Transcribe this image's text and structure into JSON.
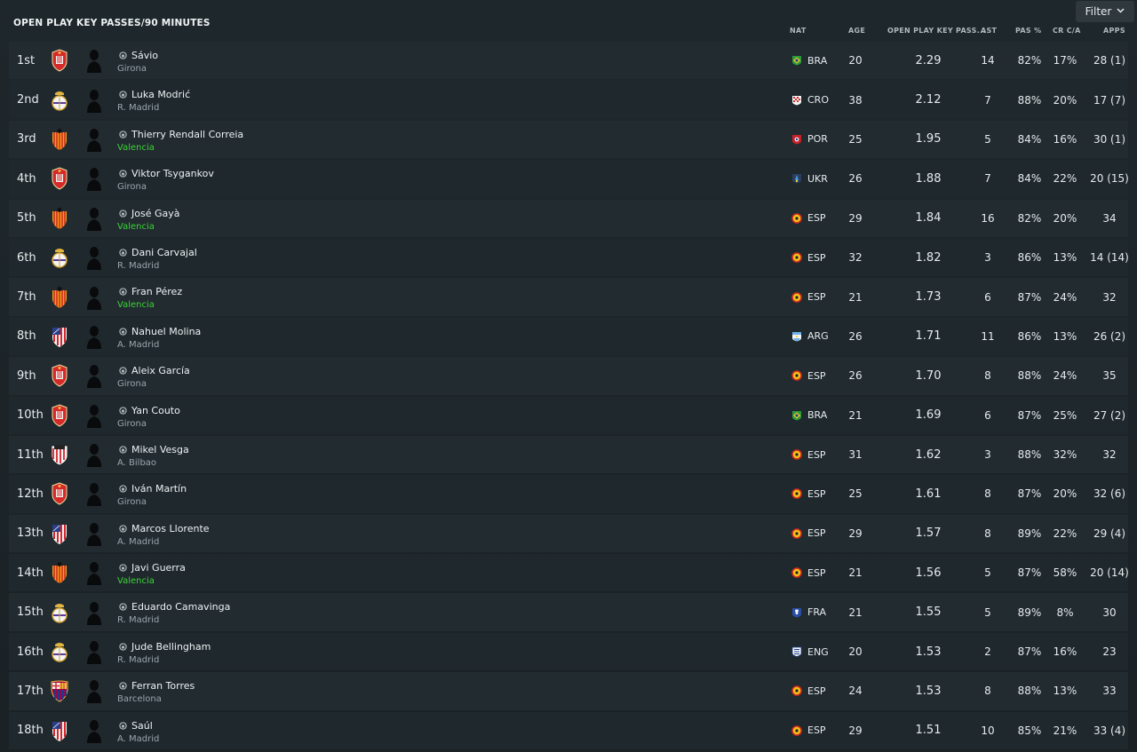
{
  "title": "OPEN PLAY KEY PASSES/90 MINUTES",
  "filter_label": "Filter",
  "columns": {
    "nat": "NAT",
    "age": "AGE",
    "kp": "OPEN PLAY KEY PASS...",
    "ast": "AST",
    "pas": "PAS %",
    "crc": "CR C/A",
    "apps": "APPS"
  },
  "colors": {
    "background": "#1b2428",
    "row": "#212b30",
    "valencia_text": "#3cd435",
    "club_text": "#9aa6ac"
  },
  "rows": [
    {
      "rank": "1st",
      "club_icon": "girona",
      "name": "Sávio",
      "club": "Girona",
      "nat_icon": "bra-flag",
      "nat": "BRA",
      "age": "20",
      "kp": "2.29",
      "ast": "14",
      "pas": "82%",
      "crc": "17%",
      "apps": "28 (1)"
    },
    {
      "rank": "2nd",
      "club_icon": "real-madrid",
      "name": "Luka Modrić",
      "club": "R. Madrid",
      "nat_icon": "cro-flag",
      "nat": "CRO",
      "age": "38",
      "kp": "2.12",
      "ast": "7",
      "pas": "88%",
      "crc": "20%",
      "apps": "17 (7)"
    },
    {
      "rank": "3rd",
      "club_icon": "valencia",
      "name": "Thierry Rendall Correia",
      "club": "Valencia",
      "nat_icon": "por-flag",
      "nat": "POR",
      "age": "25",
      "kp": "1.95",
      "ast": "5",
      "pas": "84%",
      "crc": "16%",
      "apps": "30 (1)"
    },
    {
      "rank": "4th",
      "club_icon": "girona",
      "name": "Viktor Tsygankov",
      "club": "Girona",
      "nat_icon": "ukr-flag",
      "nat": "UKR",
      "age": "26",
      "kp": "1.88",
      "ast": "7",
      "pas": "84%",
      "crc": "22%",
      "apps": "20 (15)"
    },
    {
      "rank": "5th",
      "club_icon": "valencia",
      "name": "José Gayà",
      "club": "Valencia",
      "nat_icon": "esp-flag",
      "nat": "ESP",
      "age": "29",
      "kp": "1.84",
      "ast": "16",
      "pas": "82%",
      "crc": "20%",
      "apps": "34"
    },
    {
      "rank": "6th",
      "club_icon": "real-madrid",
      "name": "Dani Carvajal",
      "club": "R. Madrid",
      "nat_icon": "esp-flag",
      "nat": "ESP",
      "age": "32",
      "kp": "1.82",
      "ast": "3",
      "pas": "86%",
      "crc": "13%",
      "apps": "14 (14)"
    },
    {
      "rank": "7th",
      "club_icon": "valencia",
      "name": "Fran Pérez",
      "club": "Valencia",
      "nat_icon": "esp-flag",
      "nat": "ESP",
      "age": "21",
      "kp": "1.73",
      "ast": "6",
      "pas": "87%",
      "crc": "24%",
      "apps": "32"
    },
    {
      "rank": "8th",
      "club_icon": "atletico",
      "name": "Nahuel Molina",
      "club": "A. Madrid",
      "nat_icon": "arg-flag",
      "nat": "ARG",
      "age": "26",
      "kp": "1.71",
      "ast": "11",
      "pas": "86%",
      "crc": "13%",
      "apps": "26 (2)"
    },
    {
      "rank": "9th",
      "club_icon": "girona",
      "name": "Aleix García",
      "club": "Girona",
      "nat_icon": "esp-flag",
      "nat": "ESP",
      "age": "26",
      "kp": "1.70",
      "ast": "8",
      "pas": "88%",
      "crc": "24%",
      "apps": "35"
    },
    {
      "rank": "10th",
      "club_icon": "girona",
      "name": "Yan Couto",
      "club": "Girona",
      "nat_icon": "bra-flag",
      "nat": "BRA",
      "age": "21",
      "kp": "1.69",
      "ast": "6",
      "pas": "87%",
      "crc": "25%",
      "apps": "27 (2)"
    },
    {
      "rank": "11th",
      "club_icon": "athletic",
      "name": "Mikel Vesga",
      "club": "A. Bilbao",
      "nat_icon": "esp-flag",
      "nat": "ESP",
      "age": "31",
      "kp": "1.62",
      "ast": "3",
      "pas": "88%",
      "crc": "32%",
      "apps": "32"
    },
    {
      "rank": "12th",
      "club_icon": "girona",
      "name": "Iván Martín",
      "club": "Girona",
      "nat_icon": "esp-flag",
      "nat": "ESP",
      "age": "25",
      "kp": "1.61",
      "ast": "8",
      "pas": "87%",
      "crc": "20%",
      "apps": "32 (6)"
    },
    {
      "rank": "13th",
      "club_icon": "atletico",
      "name": "Marcos Llorente",
      "club": "A. Madrid",
      "nat_icon": "esp-flag",
      "nat": "ESP",
      "age": "29",
      "kp": "1.57",
      "ast": "8",
      "pas": "89%",
      "crc": "22%",
      "apps": "29 (4)"
    },
    {
      "rank": "14th",
      "club_icon": "valencia",
      "name": "Javi Guerra",
      "club": "Valencia",
      "nat_icon": "esp-flag",
      "nat": "ESP",
      "age": "21",
      "kp": "1.56",
      "ast": "5",
      "pas": "87%",
      "crc": "58%",
      "apps": "20 (14)"
    },
    {
      "rank": "15th",
      "club_icon": "real-madrid",
      "name": "Eduardo Camavinga",
      "club": "R. Madrid",
      "nat_icon": "fra-flag",
      "nat": "FRA",
      "age": "21",
      "kp": "1.55",
      "ast": "5",
      "pas": "89%",
      "crc": "8%",
      "apps": "30"
    },
    {
      "rank": "16th",
      "club_icon": "real-madrid",
      "name": "Jude Bellingham",
      "club": "R. Madrid",
      "nat_icon": "eng-flag",
      "nat": "ENG",
      "age": "20",
      "kp": "1.53",
      "ast": "2",
      "pas": "87%",
      "crc": "16%",
      "apps": "23"
    },
    {
      "rank": "17th",
      "club_icon": "barcelona",
      "name": "Ferran Torres",
      "club": "Barcelona",
      "nat_icon": "esp-flag",
      "nat": "ESP",
      "age": "24",
      "kp": "1.53",
      "ast": "8",
      "pas": "88%",
      "crc": "13%",
      "apps": "33"
    },
    {
      "rank": "18th",
      "club_icon": "atletico",
      "name": "Saúl",
      "club": "A. Madrid",
      "nat_icon": "esp-flag",
      "nat": "ESP",
      "age": "29",
      "kp": "1.51",
      "ast": "10",
      "pas": "85%",
      "crc": "21%",
      "apps": "33 (4)"
    }
  ]
}
